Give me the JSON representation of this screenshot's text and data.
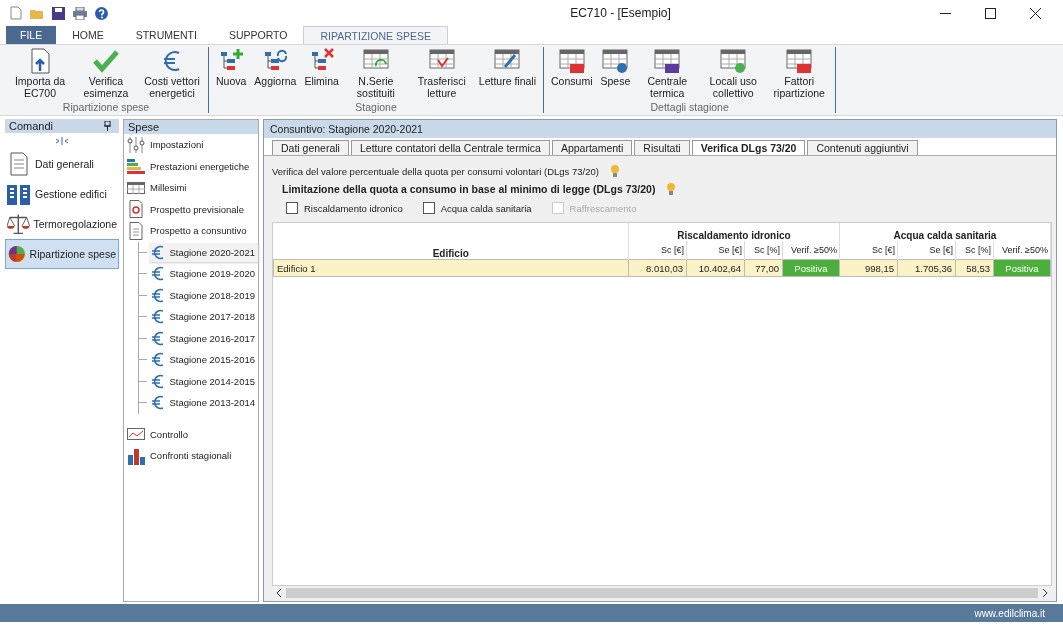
{
  "window": {
    "title": "EC710 - [Esempio]"
  },
  "ribbon_tabs": [
    {
      "label": "FILE",
      "kind": "file",
      "selected": false
    },
    {
      "label": "HOME",
      "kind": "tab",
      "selected": false
    },
    {
      "label": "STRUMENTI",
      "kind": "tab",
      "selected": false
    },
    {
      "label": "SUPPORTO",
      "kind": "tab",
      "selected": false
    },
    {
      "label": "RIPARTIZIONE SPESE",
      "kind": "tab",
      "selected": true
    }
  ],
  "ribbon_groups": [
    {
      "label": "Ripartizione spese",
      "buttons": [
        {
          "label": "Importa da EC700"
        },
        {
          "label": "Verifica esimenza"
        },
        {
          "label": "Costi vettori energetici"
        }
      ]
    },
    {
      "label": "Stagione",
      "buttons": [
        {
          "label": "Nuova"
        },
        {
          "label": "Aggiorna"
        },
        {
          "label": "Elimina"
        },
        {
          "label": "N.Serie sostituiti"
        },
        {
          "label": "Trasferisci letture"
        },
        {
          "label": "Letture finali"
        }
      ]
    },
    {
      "label": "Dettagli stagione",
      "buttons": [
        {
          "label": "Consumi"
        },
        {
          "label": "Spese"
        },
        {
          "label": "Centrale termica"
        },
        {
          "label": "Locali uso collettivo"
        },
        {
          "label": "Fattori ripartizione"
        }
      ]
    }
  ],
  "commands_panel": {
    "title": "Comandi",
    "items": [
      {
        "label": "Dati generali",
        "selected": false
      },
      {
        "label": "Gestione edifici",
        "selected": false
      },
      {
        "label": "Termoregolazione",
        "selected": false
      },
      {
        "label": "Ripartizione spese",
        "selected": true
      }
    ]
  },
  "spese_panel": {
    "title": "Spese",
    "items": [
      {
        "label": "Impostazioni"
      },
      {
        "label": "Prestazioni energetiche"
      },
      {
        "label": "Millesimi"
      },
      {
        "label": "Prospetto previsionale"
      },
      {
        "label": "Prospetto a consuntivo",
        "children": [
          {
            "label": "Stagione 2020-2021",
            "selected": true
          },
          {
            "label": "Stagione 2019-2020",
            "selected": false
          },
          {
            "label": "Stagione 2018-2019",
            "selected": false
          },
          {
            "label": "Stagione 2017-2018",
            "selected": false
          },
          {
            "label": "Stagione 2016-2017",
            "selected": false
          },
          {
            "label": "Stagione 2015-2016",
            "selected": false
          },
          {
            "label": "Stagione 2014-2015",
            "selected": false
          },
          {
            "label": "Stagione 2013-2014",
            "selected": false
          }
        ]
      },
      {
        "label": "Controllo"
      },
      {
        "label": "Confronti stagionali"
      }
    ]
  },
  "content": {
    "title": "Consuntivo: Stagione 2020-2021",
    "tabs": [
      {
        "label": "Dati generali",
        "selected": false
      },
      {
        "label": "Letture contatori della Centrale termica",
        "selected": false
      },
      {
        "label": "Appartamenti",
        "selected": false
      },
      {
        "label": "Risultati",
        "selected": false
      },
      {
        "label": "Verifica DLgs 73/20",
        "selected": true
      },
      {
        "label": "Contenuti aggiuntivi",
        "selected": false
      }
    ],
    "description": "Verifica del valore percentuale della quota per consumi volontari (DLgs 73/20)",
    "limit_title": "Limitazione della quota a consumo in base al minimo di legge (DLgs 73/20)",
    "checkboxes": [
      {
        "label": "Riscaldamento idronico",
        "checked": false,
        "disabled": false
      },
      {
        "label": "Acqua calda sanitaria",
        "checked": false,
        "disabled": false
      },
      {
        "label": "Raffrescamento",
        "checked": false,
        "disabled": true
      }
    ],
    "table": {
      "first_column": "Edificio",
      "groups": [
        {
          "title": "Riscaldamento idronico",
          "columns": [
            "Sc [€]",
            "Se [€]",
            "Sc [%]",
            "Verif. ≥50%"
          ]
        },
        {
          "title": "Acqua calda sanitaria",
          "columns": [
            "Sc [€]",
            "Se [€]",
            "Sc [%]",
            "Verif. ≥50%"
          ]
        }
      ],
      "rows": [
        {
          "name": "Edificio 1",
          "selected": true,
          "groups": [
            {
              "values": [
                "8.010,03",
                "10.402,64",
                "77,00"
              ],
              "verdict": "Positiva",
              "positive": true
            },
            {
              "values": [
                "998,15",
                "1.705,36",
                "58,53"
              ],
              "verdict": "Positiva",
              "positive": true
            }
          ]
        }
      ]
    }
  },
  "status_bar": {
    "text": "www.edilclima.it"
  }
}
